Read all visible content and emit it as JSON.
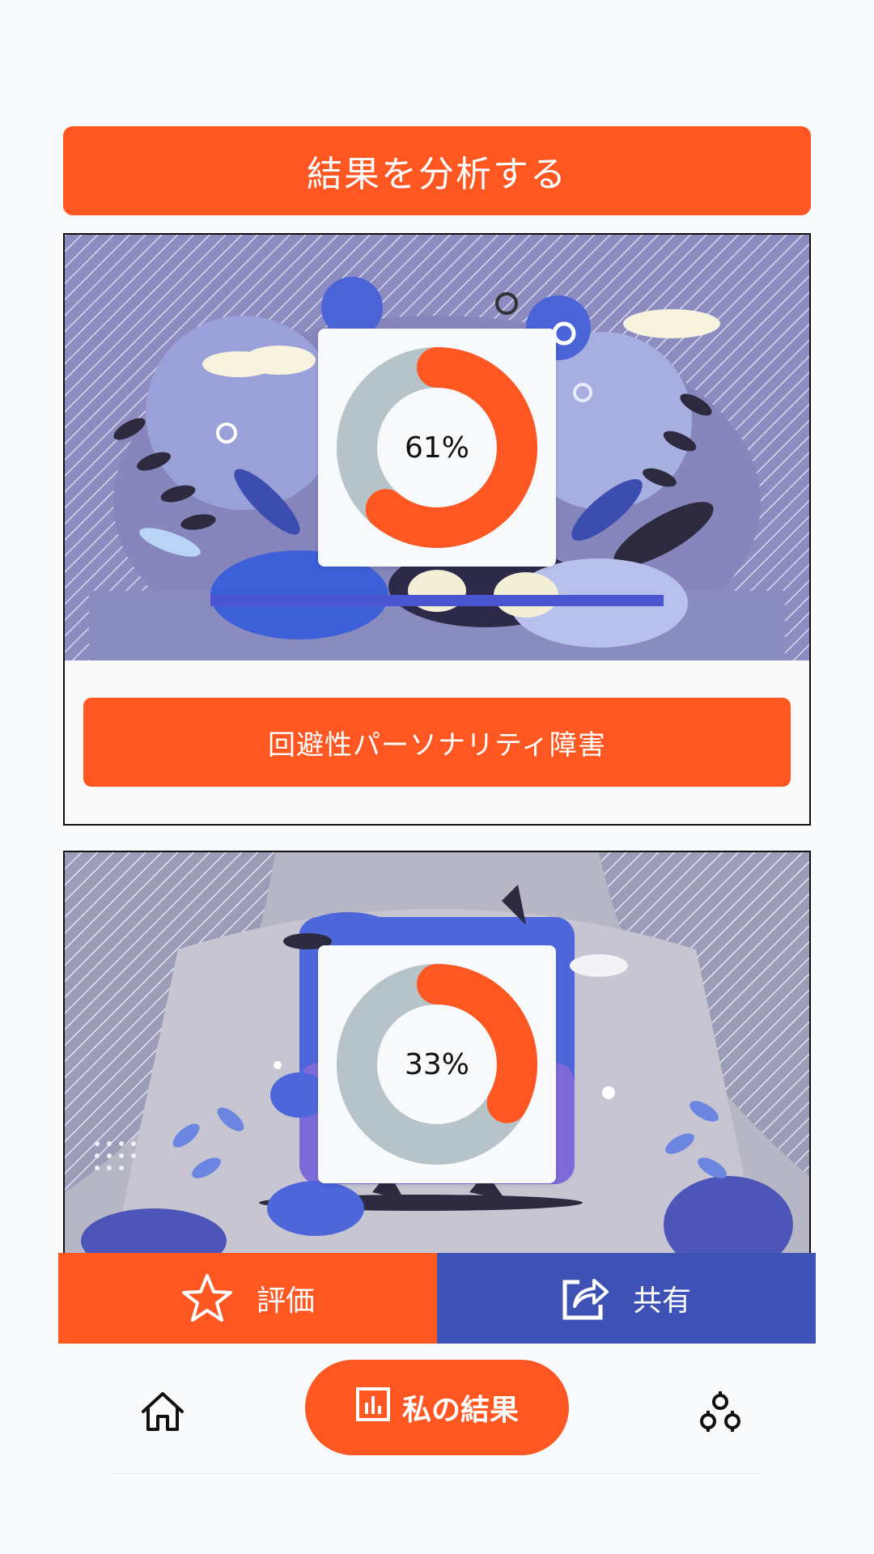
{
  "header": {
    "analyze_label": "結果を分析する"
  },
  "results": [
    {
      "percent_label": "61%",
      "percent_value": 61,
      "diagnosis_label": "回避性パーソナリティ障害"
    },
    {
      "percent_label": "33%",
      "percent_value": 33
    }
  ],
  "actions": {
    "rate_label": "評価",
    "share_label": "共有"
  },
  "nav": {
    "results_label": "私の結果",
    "home_icon": "home-icon",
    "settings_icon": "cogs-icon",
    "results_icon": "bar-chart-icon"
  },
  "colors": {
    "accent": "#fe5722",
    "share": "#3e51b5",
    "donut_track": "#b6c3c8",
    "background": "#f9fafb"
  }
}
